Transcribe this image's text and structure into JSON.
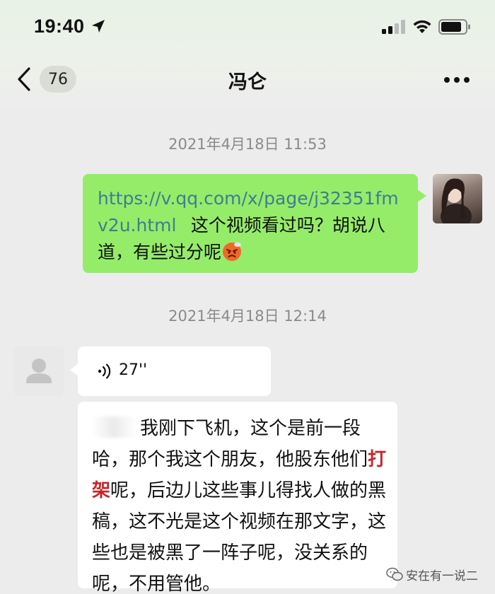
{
  "status_bar": {
    "time": "19:40"
  },
  "nav": {
    "unread_count": "76",
    "title": "冯仑"
  },
  "messages": {
    "timestamp_1": "2021年4月18日 11:53",
    "outgoing": {
      "link": "https://v.qq.com/x/page/j32351fmv2u.html",
      "text": "这个视频看过吗？胡说八道，有些过分呢"
    },
    "timestamp_2": "2021年4月18日 12:14",
    "voice": {
      "duration": "27''"
    },
    "incoming": {
      "text_1": "我刚下飞机，这个是前一段哈，那个我这个朋友，他股东他们",
      "text_highlight": "打架",
      "text_2": "呢，后边儿这些事儿得找人做的黑稿，这不光是这个视频在那文字，这些也是被黑了一阵子呢，没关系的呢，不用管他。"
    }
  },
  "watermark": {
    "text": "安在有一说二"
  },
  "icons": {
    "location": "location-arrow-icon",
    "signal": "cellular-signal-icon",
    "wifi": "wifi-icon",
    "battery": "battery-icon",
    "back": "chevron-left-icon",
    "more": "more-dots-icon",
    "voice": "voice-wave-icon",
    "emoji": "angry-face-emoji",
    "avatar_default": "default-avatar-icon"
  },
  "colors": {
    "outgoing_bubble": "#95ec69",
    "link": "#3f7d92",
    "highlight": "#c4282c",
    "background": "#ececec"
  }
}
